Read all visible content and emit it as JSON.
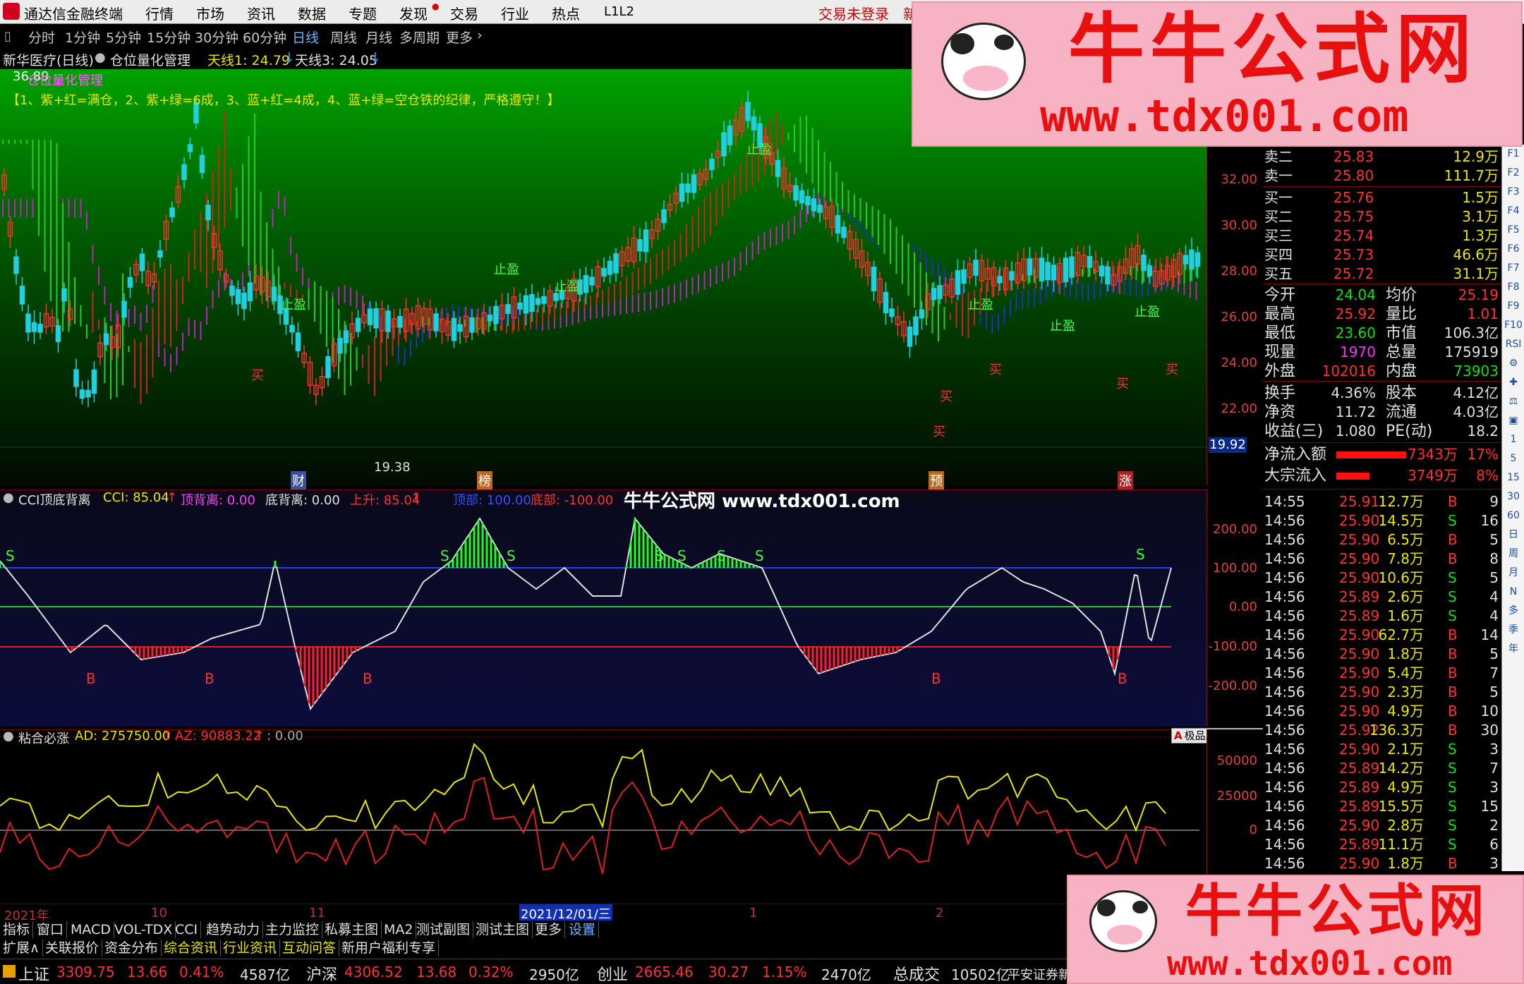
{
  "app": {
    "title": "通达信金融终端",
    "login": "交易未登录",
    "login_extra": "新",
    "menu": [
      "行情",
      "市场",
      "资讯",
      "数据",
      "专题",
      "发现",
      "交易",
      "行业",
      "热点",
      "L1L2"
    ]
  },
  "periods": [
    "分时",
    "1分钟",
    "5分钟",
    "15分钟",
    "30分钟",
    "60分钟",
    "日线",
    "周线",
    "月线",
    "多周期",
    "更多"
  ],
  "active_period": "日线",
  "titlerow": {
    "stock": "新华医疗(日线)",
    "indicator": "仓位量化管理",
    "line1": "天线1: 24.79",
    "line1_arrow": "↓",
    "line3": "天线3: 24.05",
    "line3_arrow": "↓"
  },
  "main_chart": {
    "top_price": "36.89",
    "indicator_tag": "仓位量化管理",
    "rule": "【1、紫+红=满仓，2、紫+绿=6成，3、蓝+红=4成，4、蓝+绿=空仓铁的纪律，严格遵守！】",
    "low_label": "19.38",
    "current_axis_price": "19.92",
    "axis_prices": [
      "32.00",
      "30.00",
      "28.00",
      "26.00",
      "24.00",
      "22.00"
    ],
    "event_tags": [
      "财",
      "榜",
      "预",
      "涨"
    ],
    "signals": {
      "take_profit": "止盈",
      "buy": "买"
    }
  },
  "cci_panel": {
    "name": "CCI顶底背离",
    "cci": "CCI: 85.04",
    "cci_arrow": "↑",
    "top_div": "顶背离: 0.00",
    "bottom_div": "底背离: 0.00",
    "rise": "上升: 85.04",
    "rise_arrow": "↑",
    "top": "顶部: 100.00",
    "bottom": "底部: -100.00",
    "axis": [
      "200.00",
      "100.00",
      "0.00",
      "-100.00",
      "-200.00"
    ],
    "sell_mark": "S",
    "buy_mark": "B"
  },
  "ad_panel": {
    "name": "粘合必涨",
    "ad": "AD: 275750.00",
    "ad_arrow": "↑",
    "az": "AZ: 90883.22",
    "az_arrow": "↑",
    "zero": ": 0.00",
    "axis": [
      "50000",
      "25000",
      "0"
    ],
    "tool_label": "极品五笔"
  },
  "watermark": {
    "inline": "牛牛公式网 www.tdx001.com",
    "banner_title": "牛牛公式网",
    "banner_url": "www.tdx001.com"
  },
  "datebar": {
    "year": "2021年",
    "m1": "10",
    "m2": "11",
    "cursor_date": "2021/12/01/三",
    "m3": "1",
    "m4": "2"
  },
  "tabs1": [
    "指标",
    "窗口",
    "MACD",
    "VOL-TDX",
    "CCI",
    "趋势动力",
    "主力监控",
    "私募主图",
    "MA2",
    "测试副图",
    "测试主图",
    "更多",
    "设置"
  ],
  "tabs2": [
    "扩展∧",
    "关联报价",
    "资金分布",
    "综合资讯",
    "行业资讯",
    "互动问答",
    "新用户福利专享"
  ],
  "index_bar": {
    "sh_label": "上证",
    "sh_val": "3309.75",
    "sh_chg": "13.66",
    "sh_pct": "0.41%",
    "sh_amt": "4587亿",
    "hs_label": "沪深",
    "hs_val": "4306.52",
    "hs_chg": "13.68",
    "hs_pct": "0.32%",
    "hs_amt": "2950亿",
    "cy_label": "创业",
    "cy_val": "2665.46",
    "cy_chg": "30.27",
    "cy_pct": "1.15%",
    "cy_amt": "2470亿",
    "total_label": "总成交",
    "total_val": "10502亿",
    "broker": "平安证券新"
  },
  "quote": {
    "asks": [
      {
        "label": "卖二",
        "price": "25.83",
        "vol": "12.9万"
      },
      {
        "label": "卖一",
        "price": "25.80",
        "vol": "111.7万"
      }
    ],
    "bids": [
      {
        "label": "买一",
        "price": "25.76",
        "vol": "1.5万"
      },
      {
        "label": "买二",
        "price": "25.75",
        "vol": "3.1万"
      },
      {
        "label": "买三",
        "price": "25.74",
        "vol": "1.3万"
      },
      {
        "label": "买四",
        "price": "25.73",
        "vol": "46.6万"
      },
      {
        "label": "买五",
        "price": "25.72",
        "vol": "31.1万"
      }
    ],
    "stats": [
      {
        "l1": "今开",
        "v1": "24.04",
        "l2": "均价",
        "v2": "25.19",
        "c1": "#10e010",
        "c2": "#ff3030"
      },
      {
        "l1": "最高",
        "v1": "25.92",
        "l2": "量比",
        "v2": "1.01",
        "c1": "#ff3030",
        "c2": "#ff3030"
      },
      {
        "l1": "最低",
        "v1": "23.60",
        "l2": "市值",
        "v2": "106.3亿",
        "c1": "#10e010",
        "c2": "#e0e0e0"
      },
      {
        "l1": "现量",
        "v1": "1970",
        "l2": "总量",
        "v2": "175919",
        "c1": "#ff30ff",
        "c2": "#e0e0e0"
      },
      {
        "l1": "外盘",
        "v1": "102016",
        "l2": "内盘",
        "v2": "73903",
        "c1": "#ff3030",
        "c2": "#10e010"
      },
      {
        "l1": "换手",
        "v1": "4.36%",
        "l2": "股本",
        "v2": "4.12亿",
        "c1": "#e0e0e0",
        "c2": "#e0e0e0"
      },
      {
        "l1": "净资",
        "v1": "11.72",
        "l2": "流通",
        "v2": "4.03亿",
        "c1": "#e0e0e0",
        "c2": "#e0e0e0"
      },
      {
        "l1": "收益(三)",
        "v1": "1.080",
        "l2": "PE(动)",
        "v2": "18.2",
        "c1": "#e0e0e0",
        "c2": "#e0e0e0"
      }
    ],
    "flows": [
      {
        "label": "净流入额",
        "val": "7343万",
        "pct": "17%",
        "bar": 0.95
      },
      {
        "label": "大宗流入",
        "val": "3749万",
        "pct": "8%",
        "bar": 0.45
      }
    ],
    "ticks": [
      {
        "t": "14:55",
        "p": "25.91",
        "v": "12.7万",
        "d": "B",
        "n": "9"
      },
      {
        "t": "14:56",
        "p": "25.90",
        "v": "14.5万",
        "d": "S",
        "n": "16"
      },
      {
        "t": "14:56",
        "p": "25.90",
        "v": "6.5万",
        "d": "B",
        "n": "5"
      },
      {
        "t": "14:56",
        "p": "25.90",
        "v": "7.8万",
        "d": "B",
        "n": "8"
      },
      {
        "t": "14:56",
        "p": "25.90",
        "v": "10.6万",
        "d": "S",
        "n": "5"
      },
      {
        "t": "14:56",
        "p": "25.89",
        "v": "2.6万",
        "d": "S",
        "n": "4"
      },
      {
        "t": "14:56",
        "p": "25.89",
        "v": "1.6万",
        "d": "S",
        "n": "4"
      },
      {
        "t": "14:56",
        "p": "25.90",
        "v": "62.7万",
        "d": "B",
        "n": "14"
      },
      {
        "t": "14:56",
        "p": "25.90",
        "v": "1.8万",
        "d": "B",
        "n": "5"
      },
      {
        "t": "14:56",
        "p": "25.90",
        "v": "5.4万",
        "d": "B",
        "n": "7"
      },
      {
        "t": "14:56",
        "p": "25.90",
        "v": "2.3万",
        "d": "B",
        "n": "5"
      },
      {
        "t": "14:56",
        "p": "25.90",
        "v": "4.9万",
        "d": "B",
        "n": "10"
      },
      {
        "t": "14:56",
        "p": "25.92",
        "v": "136.3万",
        "d": "B",
        "n": "30"
      },
      {
        "t": "14:56",
        "p": "25.90",
        "v": "2.1万",
        "d": "S",
        "n": "3"
      },
      {
        "t": "14:56",
        "p": "25.89",
        "v": "14.2万",
        "d": "S",
        "n": "7"
      },
      {
        "t": "14:56",
        "p": "25.89",
        "v": "4.9万",
        "d": "S",
        "n": "3"
      },
      {
        "t": "14:56",
        "p": "25.89",
        "v": "15.5万",
        "d": "S",
        "n": "15"
      },
      {
        "t": "14:56",
        "p": "25.90",
        "v": "2.8万",
        "d": "S",
        "n": "2"
      },
      {
        "t": "14:56",
        "p": "25.89",
        "v": "11.1万",
        "d": "S",
        "n": "6"
      },
      {
        "t": "14:56",
        "p": "25.90",
        "v": "1.8万",
        "d": "B",
        "n": "3"
      }
    ]
  },
  "rightbar": [
    "F1",
    "F2",
    "F3",
    "F4",
    "F5",
    "F6",
    "F7",
    "F8",
    "F9",
    "F10",
    "RSI",
    "⚙",
    "✚",
    "⚖",
    "▣",
    "1",
    "5",
    "15",
    "30",
    "60",
    "日",
    "周",
    "月",
    "N",
    "多",
    "季",
    "年"
  ]
}
